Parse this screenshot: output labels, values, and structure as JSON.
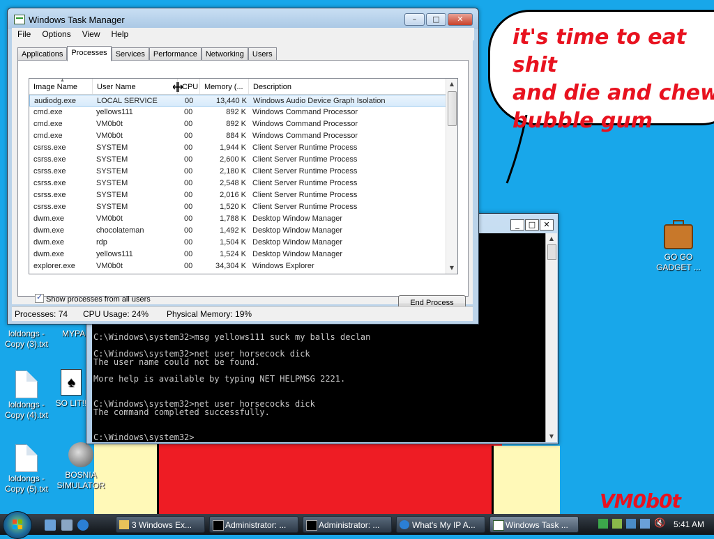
{
  "desktop": {
    "speech_bubble": "it's time to eat shit\nand die and chew\nbubble gum",
    "signature": "VM0b0t",
    "icons": [
      {
        "label": "loldongs - Copy (3).txt"
      },
      {
        "label": "MYPA"
      },
      {
        "label": "loldongs - Copy (4).txt"
      },
      {
        "label": "SO LIT!!"
      },
      {
        "label": "loldongs - Copy (5).txt"
      },
      {
        "label": "BOSNIA SIMULATOR"
      },
      {
        "label": "GO GO GADGET ..."
      }
    ]
  },
  "task_manager": {
    "title": "Windows Task Manager",
    "menu": [
      "File",
      "Options",
      "View",
      "Help"
    ],
    "tabs": [
      "Applications",
      "Processes",
      "Services",
      "Performance",
      "Networking",
      "Users"
    ],
    "active_tab": "Processes",
    "columns": [
      "Image Name",
      "User Name",
      "CPU",
      "Memory (...",
      "Description"
    ],
    "rows": [
      {
        "image": "audiodg.exe",
        "user": "LOCAL SERVICE",
        "cpu": "00",
        "mem": "13,440 K",
        "desc": "Windows Audio Device Graph Isolation",
        "selected": true
      },
      {
        "image": "cmd.exe",
        "user": "yellows111",
        "cpu": "00",
        "mem": "892 K",
        "desc": "Windows Command Processor"
      },
      {
        "image": "cmd.exe",
        "user": "VM0b0t",
        "cpu": "00",
        "mem": "892 K",
        "desc": "Windows Command Processor"
      },
      {
        "image": "cmd.exe",
        "user": "VM0b0t",
        "cpu": "00",
        "mem": "884 K",
        "desc": "Windows Command Processor"
      },
      {
        "image": "csrss.exe",
        "user": "SYSTEM",
        "cpu": "00",
        "mem": "1,944 K",
        "desc": "Client Server Runtime Process"
      },
      {
        "image": "csrss.exe",
        "user": "SYSTEM",
        "cpu": "00",
        "mem": "2,600 K",
        "desc": "Client Server Runtime Process"
      },
      {
        "image": "csrss.exe",
        "user": "SYSTEM",
        "cpu": "00",
        "mem": "2,180 K",
        "desc": "Client Server Runtime Process"
      },
      {
        "image": "csrss.exe",
        "user": "SYSTEM",
        "cpu": "00",
        "mem": "2,548 K",
        "desc": "Client Server Runtime Process"
      },
      {
        "image": "csrss.exe",
        "user": "SYSTEM",
        "cpu": "00",
        "mem": "2,016 K",
        "desc": "Client Server Runtime Process"
      },
      {
        "image": "csrss.exe",
        "user": "SYSTEM",
        "cpu": "00",
        "mem": "1,520 K",
        "desc": "Client Server Runtime Process"
      },
      {
        "image": "dwm.exe",
        "user": "VM0b0t",
        "cpu": "00",
        "mem": "1,788 K",
        "desc": "Desktop Window Manager"
      },
      {
        "image": "dwm.exe",
        "user": "chocolateman",
        "cpu": "00",
        "mem": "1,492 K",
        "desc": "Desktop Window Manager"
      },
      {
        "image": "dwm.exe",
        "user": "rdp",
        "cpu": "00",
        "mem": "1,504 K",
        "desc": "Desktop Window Manager"
      },
      {
        "image": "dwm.exe",
        "user": "yellows111",
        "cpu": "00",
        "mem": "1,524 K",
        "desc": "Desktop Window Manager"
      },
      {
        "image": "explorer.exe",
        "user": "VM0b0t",
        "cpu": "00",
        "mem": "34,304 K",
        "desc": "Windows Explorer"
      }
    ],
    "show_all_users_label": "Show processes from all users",
    "show_all_users_checked": true,
    "end_process_label": "End Process",
    "status": {
      "processes": "Processes: 74",
      "cpu": "CPU Usage: 24%",
      "memory": "Physical Memory: 19%"
    }
  },
  "cmd_window": {
    "console_text": "C:\\Windows\\system32>msg yellows111 suck my balls declan\n\nC:\\Windows\\system32>net user horsecock dick\nThe user name could not be found.\n\nMore help is available by typing NET HELPMSG 2221.\n\n\nC:\\Windows\\system32>net user horsecocks dick\nThe command completed successfully.\n\n\nC:\\Windows\\system32>"
  },
  "taskbar": {
    "buttons": [
      {
        "label": "3 Windows Ex..."
      },
      {
        "label": "Administrator: ..."
      },
      {
        "label": "Administrator: ..."
      },
      {
        "label": "What's My IP A..."
      },
      {
        "label": "Windows Task ..."
      }
    ],
    "clock": "5:41 AM"
  },
  "colors": {
    "desktop": "#18a7ea",
    "paint_red": "#ee1c24",
    "paint_yellow": "#fff9b8",
    "selection": "#d8ebfb"
  }
}
